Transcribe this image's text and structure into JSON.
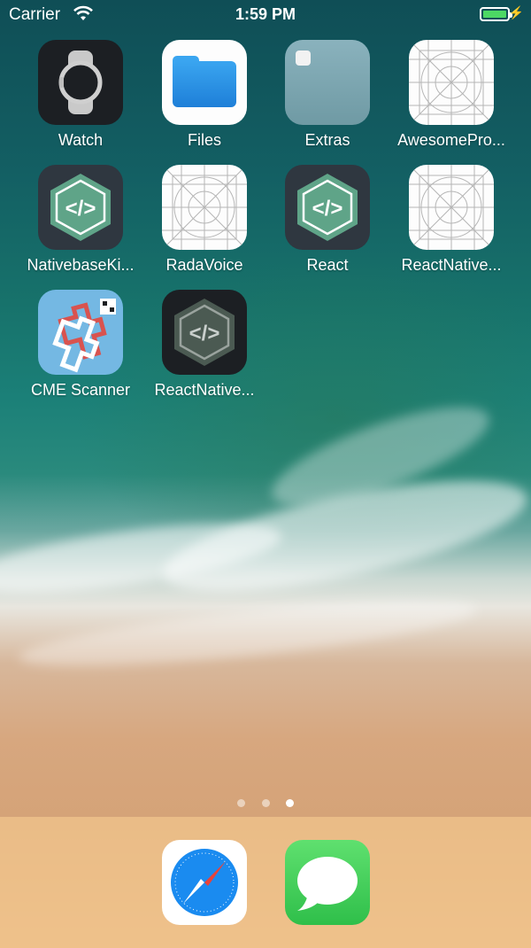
{
  "status_bar": {
    "carrier": "Carrier",
    "time": "1:59 PM",
    "battery_level": 1.0,
    "charging_icon": "bolt-icon",
    "battery_color": "#4cd964"
  },
  "apps": [
    {
      "label": "Watch",
      "icon": "watch-icon"
    },
    {
      "label": "Files",
      "icon": "folder-icon"
    },
    {
      "label": "Extras",
      "icon": "app-folder-icon"
    },
    {
      "label": "AwesomePro...",
      "icon": "blank-app-grid-icon"
    },
    {
      "label": "NativebaseKi...",
      "icon": "code-hexagon-icon"
    },
    {
      "label": "RadaVoice",
      "icon": "blank-app-grid-icon"
    },
    {
      "label": "React",
      "icon": "code-hexagon-icon"
    },
    {
      "label": "ReactNative...",
      "icon": "blank-app-grid-icon"
    },
    {
      "label": "CME Scanner",
      "icon": "cme-scanner-icon"
    },
    {
      "label": "ReactNative...",
      "icon": "code-hexagon-icon"
    }
  ],
  "page_indicator": {
    "count": 3,
    "active_index": 2
  },
  "dock": [
    {
      "name": "Safari",
      "icon": "safari-compass-icon"
    },
    {
      "name": "Messages",
      "icon": "speech-bubble-icon"
    }
  ],
  "colors": {
    "code_hexagon": "#5fa488",
    "files_blue": "#2a8fe6",
    "cme_background": "#74b8e3",
    "messages_green": "#3fd15a",
    "safari_blue": "#1a8bf0"
  }
}
